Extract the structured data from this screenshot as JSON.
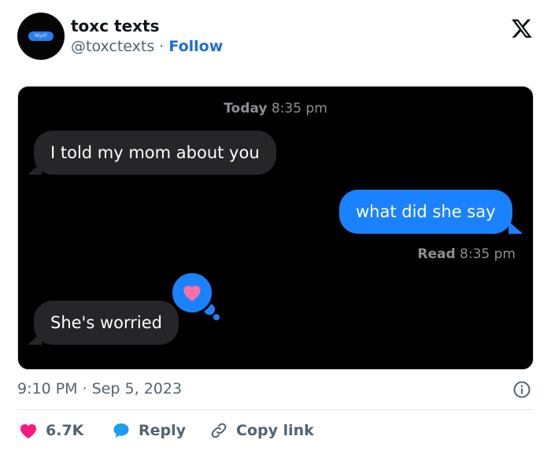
{
  "tweet": {
    "author_name": "toxc texts",
    "author_handle": "@toxctexts",
    "separator": " · ",
    "follow_label": "Follow",
    "avatar_text": "Wyd?",
    "timestamp": "9:10 PM · Sep 5, 2023"
  },
  "conversation": {
    "timestamp_day": "Today",
    "timestamp_time": " 8:35 pm",
    "messages": [
      {
        "sender": "them",
        "text": "I told my mom about you"
      },
      {
        "sender": "me",
        "text": "what did she say"
      },
      {
        "sender": "them",
        "text": "She's worried"
      }
    ],
    "read_label": "Read",
    "read_time": " 8:35 pm",
    "reaction": "heart-icon"
  },
  "actions": {
    "like_count": "6.7K",
    "reply_label": "Reply",
    "copy_label": "Copy link"
  },
  "colors": {
    "bubble_in": "#262629",
    "bubble_out": "#1a82ff",
    "like": "#f91880",
    "reply": "#1d9bf0",
    "follow": "#1d6fd8"
  }
}
